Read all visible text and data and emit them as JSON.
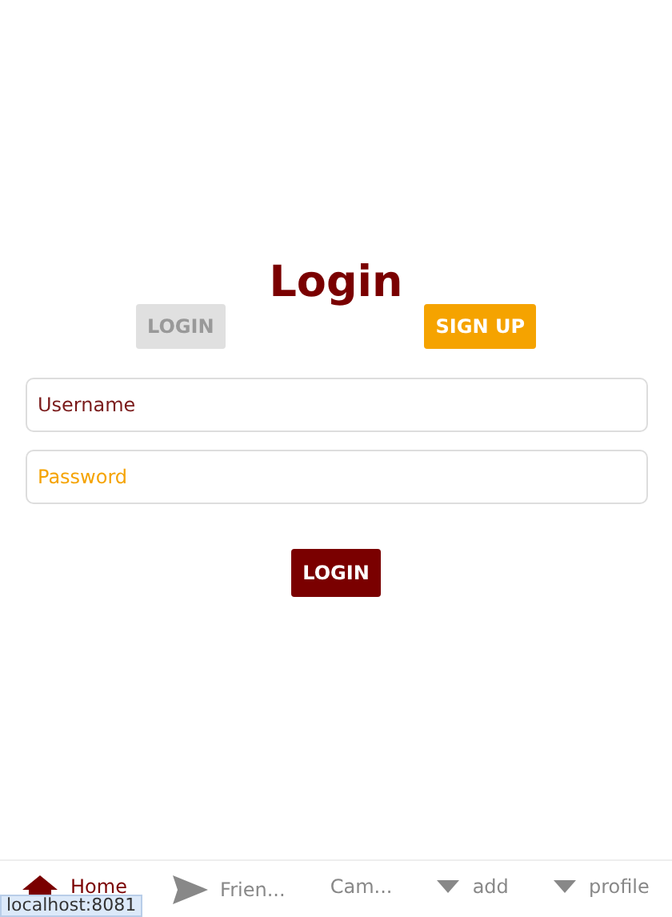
{
  "title": "Login",
  "tabs": [
    {
      "label": "LOGIN",
      "selected": true
    },
    {
      "label": "SIGN UP",
      "selected": false
    }
  ],
  "fields": [
    {
      "placeholder": "Username",
      "kind": "text"
    },
    {
      "placeholder": "Password",
      "kind": "password"
    }
  ],
  "submit": "LOGIN",
  "nav": [
    {
      "label": "Home",
      "kind": "home",
      "selected": true
    },
    {
      "label": "Frien...",
      "kind": "send",
      "selected": false
    },
    {
      "label": "Cam...",
      "kind": "plain",
      "selected": false
    },
    {
      "label": "add",
      "kind": "dropdown",
      "selected": false
    },
    {
      "label": "profile",
      "kind": "dropdown",
      "selected": false
    }
  ],
  "status_url": "localhost:8081"
}
